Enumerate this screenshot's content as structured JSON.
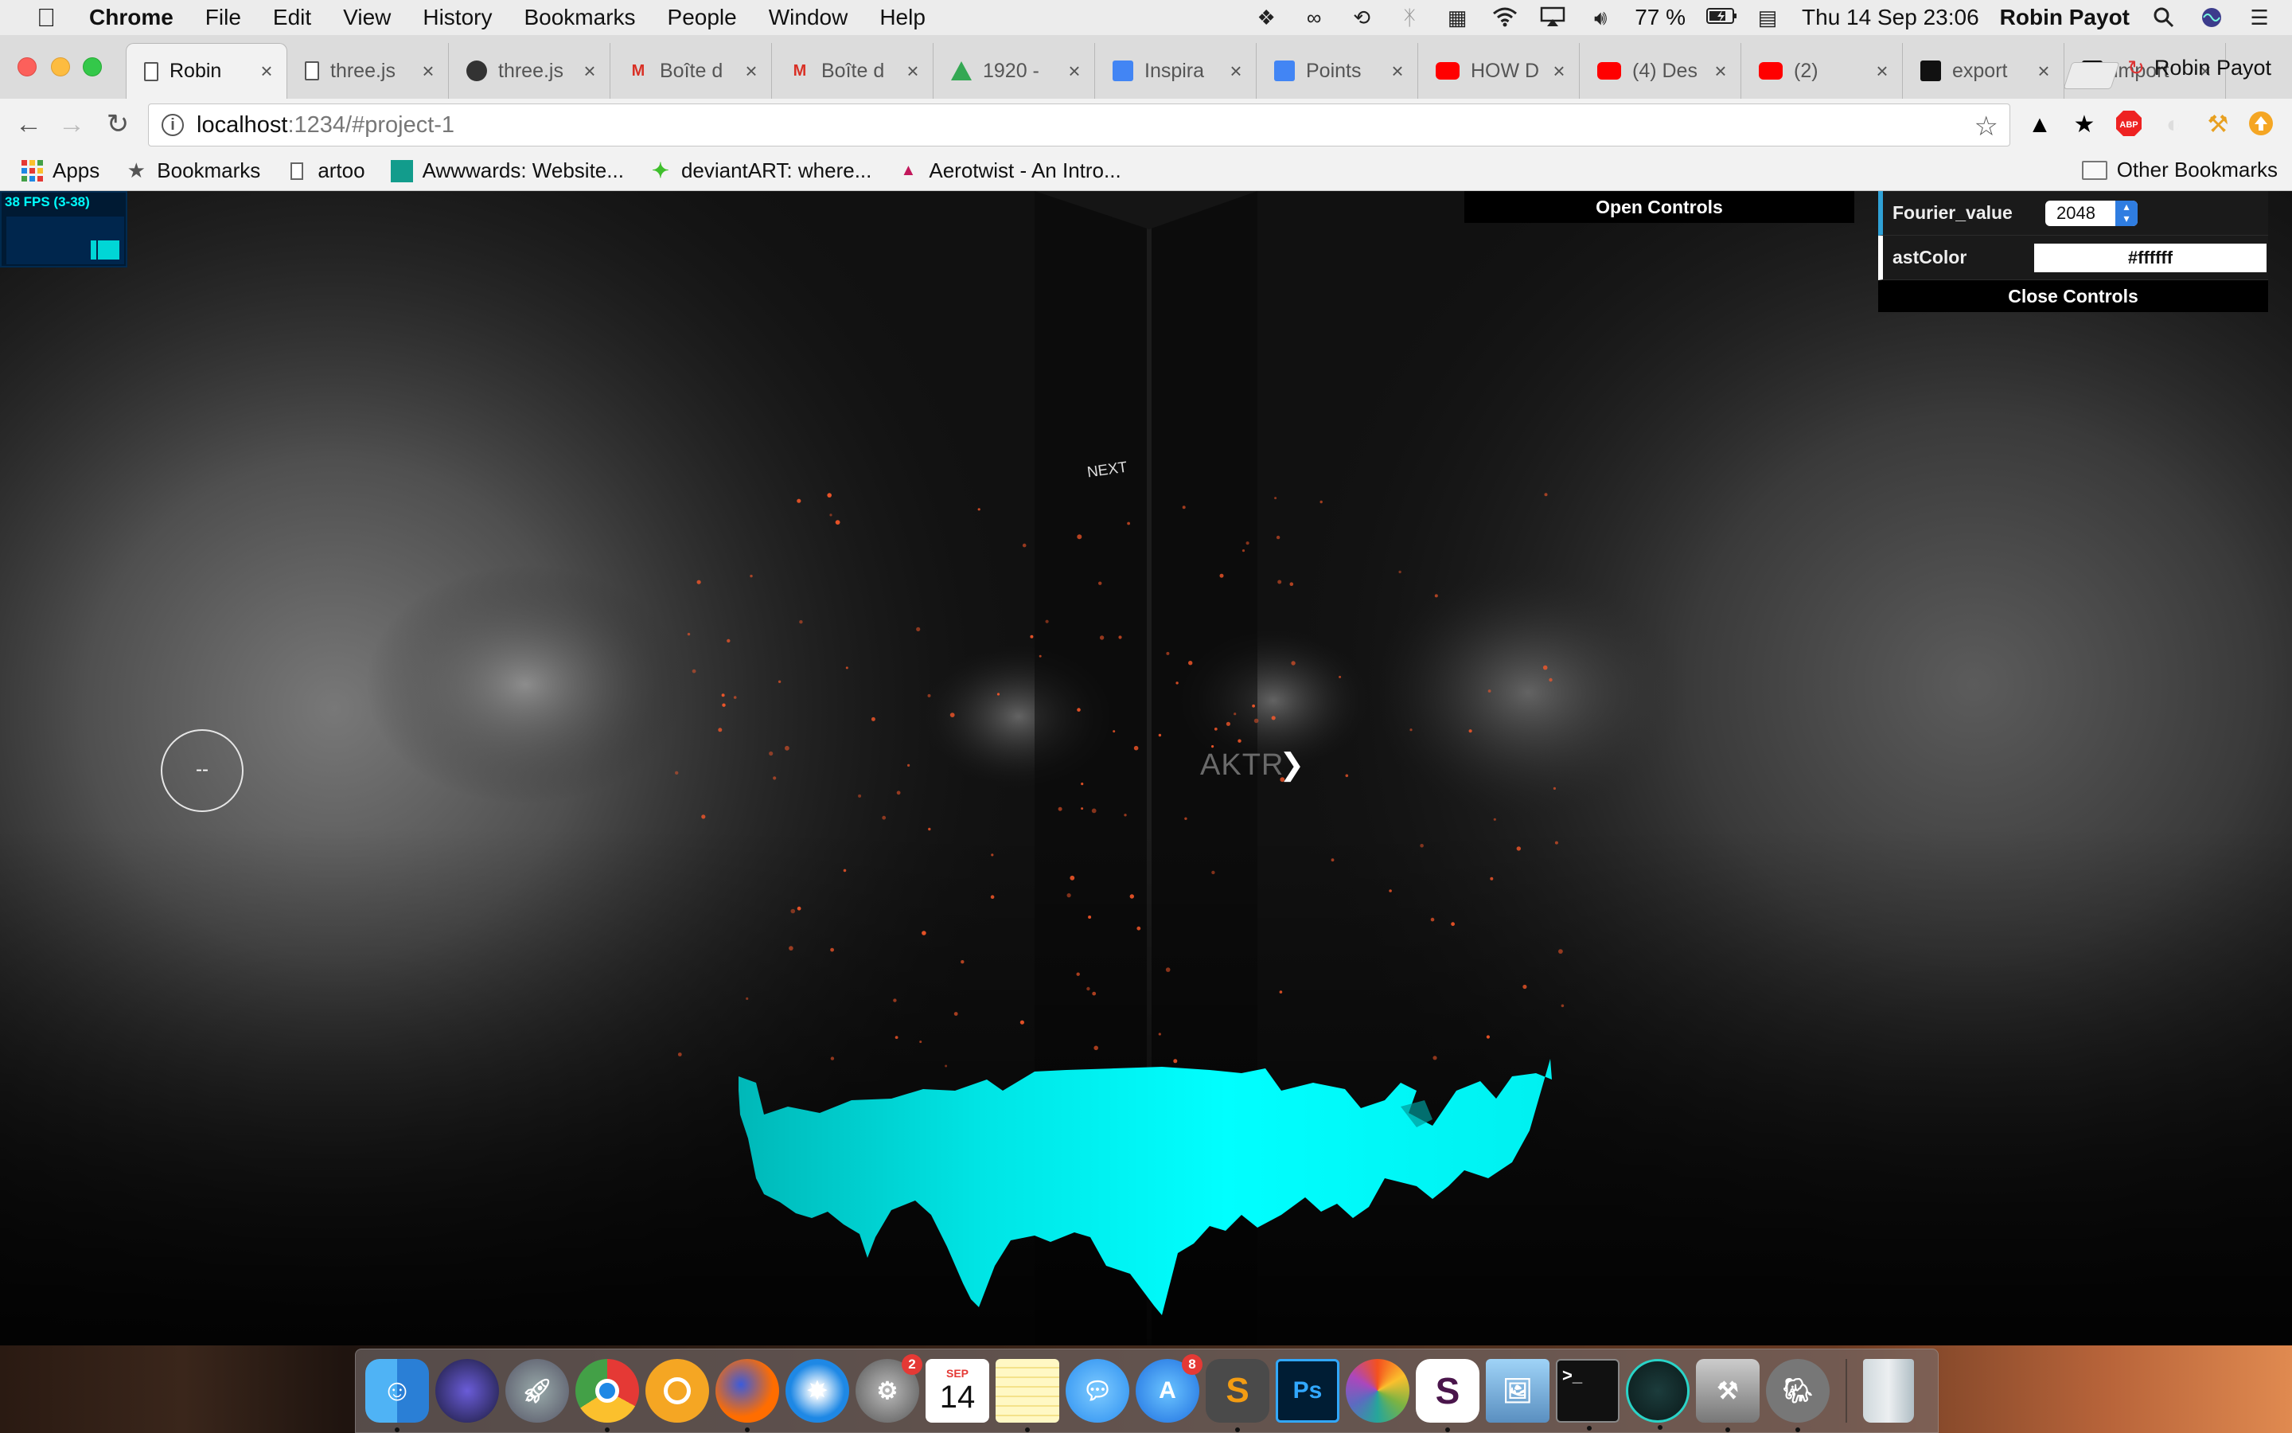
{
  "menubar": {
    "apple": "",
    "items": [
      "Chrome",
      "File",
      "Edit",
      "View",
      "History",
      "Bookmarks",
      "People",
      "Window",
      "Help"
    ],
    "battery": "77 %",
    "datetime": "Thu 14 Sep  23:06",
    "user": "Robin Payot"
  },
  "tabs": [
    {
      "title": "Robin",
      "favicon": "page-icon"
    },
    {
      "title": "three.js",
      "favicon": "page-icon"
    },
    {
      "title": "three.js",
      "favicon": "github-icon"
    },
    {
      "title": "Boîte d",
      "favicon": "gmail-icon"
    },
    {
      "title": "Boîte d",
      "favicon": "gmail-icon"
    },
    {
      "title": "1920 -",
      "favicon": "drive-icon"
    },
    {
      "title": "Inspira",
      "favicon": "docs-icon"
    },
    {
      "title": "Points",
      "favicon": "docs-icon"
    },
    {
      "title": "HOW D",
      "favicon": "youtube-icon"
    },
    {
      "title": "(4) Des",
      "favicon": "youtube-icon"
    },
    {
      "title": "(2)",
      "favicon": "youtube-icon"
    },
    {
      "title": "export",
      "favicon": "threejs-icon"
    },
    {
      "title": "import",
      "favicon": "threejs-icon"
    }
  ],
  "profile": {
    "name": "Robin Payot"
  },
  "address": {
    "host": "localhost",
    "path": ":1234/#project-1"
  },
  "bookmarks": {
    "items": [
      {
        "label": "Apps",
        "icon": "apps-grid-icon"
      },
      {
        "label": "Bookmarks",
        "icon": "star-icon"
      },
      {
        "label": "artoo",
        "icon": "page-icon"
      },
      {
        "label": "Awwwards: Website...",
        "icon": "awwwards-icon"
      },
      {
        "label": "deviantART: where...",
        "icon": "deviantart-icon"
      },
      {
        "label": "Aerotwist - An Intro...",
        "icon": "aerotwist-icon"
      }
    ],
    "other": "Other Bookmarks"
  },
  "viewport": {
    "fps": "38 FPS (3-38)",
    "open_controls": "Open Controls",
    "close_controls": "Close Controls",
    "gui": {
      "fourier_label": "Fourier_value",
      "fourier_value": "2048",
      "ast_color_label": "astColor",
      "ast_color_value": "#ffffff"
    },
    "circle_button": "--",
    "next_label": "NEXT",
    "project_label": "AKTR",
    "chevron": "❯",
    "accent_color": "#00ffff",
    "particle_color": "#ff5a2a"
  },
  "dock": {
    "apps": [
      {
        "name": "finder",
        "running": true
      },
      {
        "name": "siri",
        "running": false
      },
      {
        "name": "launchpad",
        "running": false
      },
      {
        "name": "chrome",
        "running": true
      },
      {
        "name": "chrome-canary",
        "running": false
      },
      {
        "name": "firefox",
        "running": true
      },
      {
        "name": "safari",
        "running": false
      },
      {
        "name": "system-preferences",
        "running": false,
        "badge": "2"
      },
      {
        "name": "calendar",
        "running": false,
        "month": "SEP",
        "day": "14"
      },
      {
        "name": "notes",
        "running": true
      },
      {
        "name": "messages",
        "running": false
      },
      {
        "name": "app-store",
        "running": false,
        "badge": "8"
      },
      {
        "name": "sublime-text",
        "running": true
      },
      {
        "name": "photoshop",
        "running": false,
        "label": "Ps"
      },
      {
        "name": "photos",
        "running": false
      },
      {
        "name": "slack",
        "running": true,
        "label": "S"
      },
      {
        "name": "preview",
        "running": false
      },
      {
        "name": "terminal",
        "running": true
      },
      {
        "name": "gitkraken",
        "running": true
      },
      {
        "name": "automator",
        "running": true
      },
      {
        "name": "sequel-pro",
        "running": true
      },
      {
        "name": "trash",
        "running": false
      }
    ]
  }
}
